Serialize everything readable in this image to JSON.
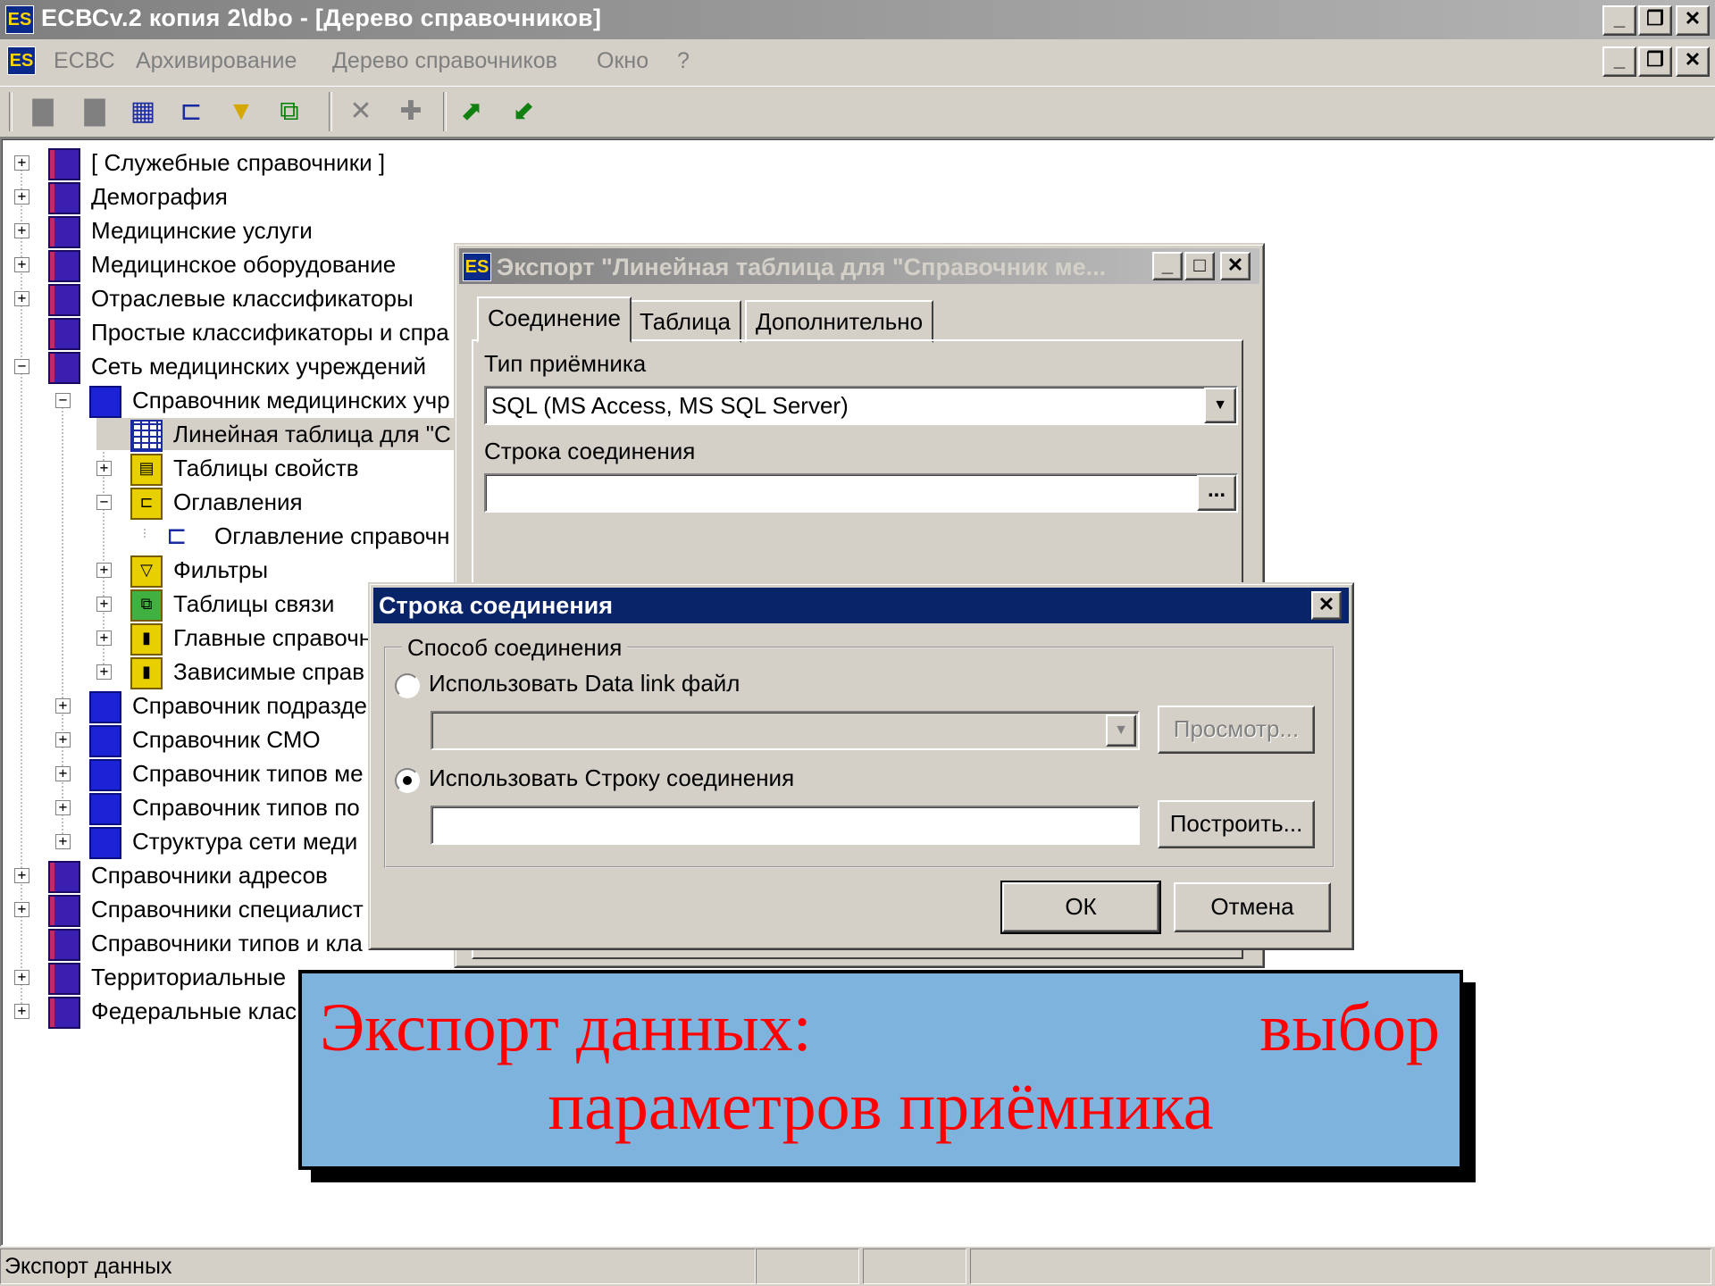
{
  "window": {
    "title": "ЕСВСv.2 копия 2\\dbo - [Дерево справочников]",
    "icon_text": "ЕS"
  },
  "menu": {
    "items": [
      {
        "label": "ЕСВС"
      },
      {
        "label": "Архивирование"
      },
      {
        "label": "Дерево справочников"
      },
      {
        "label": "Окно"
      },
      {
        "label": "?"
      }
    ]
  },
  "tree": {
    "nodes": [
      {
        "label": "[ Служебные справочники ]",
        "icon": "book-stack-icon"
      },
      {
        "label": "Демография",
        "icon": "book-stack-icon"
      },
      {
        "label": "Медицинские услуги",
        "icon": "book-stack-icon"
      },
      {
        "label": "Медицинское оборудование",
        "icon": "book-stack-icon"
      },
      {
        "label": "Отраслевые классификаторы",
        "icon": "book-stack-icon"
      },
      {
        "label": "Простые классификаторы и спра",
        "icon": "book-stack-icon"
      },
      {
        "label": "Сеть медицинских учреждений",
        "icon": "book-stack-icon"
      },
      {
        "label": "Справочник медицинских учр",
        "icon": "book-icon"
      },
      {
        "label": "Линейная таблица для \"С",
        "icon": "table-icon"
      },
      {
        "label": "Таблицы свойств",
        "icon": "property-table-icon"
      },
      {
        "label": "Оглавления",
        "icon": "contents-icon"
      },
      {
        "label": "Оглавление справочн",
        "icon": "tree-icon"
      },
      {
        "label": "Фильтры",
        "icon": "filter-icon"
      },
      {
        "label": "Таблицы связи",
        "icon": "link-table-icon"
      },
      {
        "label": "Главные справочн",
        "icon": "book-folder-icon"
      },
      {
        "label": "Зависимые справ",
        "icon": "book-folder-icon"
      },
      {
        "label": "Справочник подразде",
        "icon": "book-icon"
      },
      {
        "label": "Справочник СМО",
        "icon": "book-icon"
      },
      {
        "label": "Справочник типов ме",
        "icon": "book-icon"
      },
      {
        "label": "Справочник типов по",
        "icon": "book-icon"
      },
      {
        "label": "Структура сети меди",
        "icon": "book-icon"
      },
      {
        "label": "Справочники адресов",
        "icon": "book-stack-icon"
      },
      {
        "label": "Справочники специалист",
        "icon": "book-stack-icon"
      },
      {
        "label": "Справочники типов и кла",
        "icon": "book-stack-icon"
      },
      {
        "label": "Территориальные",
        "icon": "book-stack-icon"
      },
      {
        "label": "Федеральные клас",
        "icon": "book-stack-icon"
      }
    ]
  },
  "export_dialog": {
    "title": "Экспорт \"Линейная таблица для \"Справочник ме...",
    "tabs": [
      {
        "label": "Соединение"
      },
      {
        "label": "Таблица"
      },
      {
        "label": "Дополнительно"
      }
    ],
    "receiver_type_label": "Тип приёмника",
    "receiver_type_value": "SQL (MS Access, MS SQL Server)",
    "connection_string_label": "Строка соединения",
    "connection_string_value": "",
    "browse_label": "..."
  },
  "conn_dialog": {
    "title": "Строка соединения",
    "group_label": "Способ соединения",
    "option_datalink": "Использовать Data link файл",
    "option_string": "Использовать Строку соединения",
    "selected_option": "string",
    "view_button": "Просмотр...",
    "build_button": "Построить...",
    "ok_button": "ОК",
    "cancel_button": "Отмена"
  },
  "caption": {
    "line1_left": "Экспорт данных:",
    "line1_right": "выбор",
    "line2": "параметров приёмника"
  },
  "status": {
    "text": "Экспорт данных"
  },
  "colors": {
    "caption_bg": "#7db3dc",
    "caption_text": "#ff0000",
    "active_caption": "#0a246a"
  }
}
